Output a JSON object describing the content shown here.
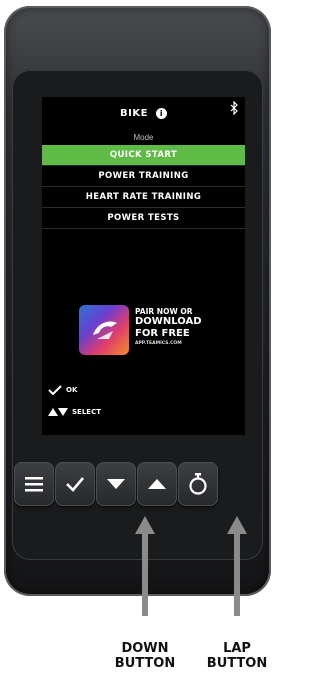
{
  "header": {
    "title": "BIKE",
    "info_glyph": "i"
  },
  "mode_label": "Mode",
  "menu": {
    "items": [
      {
        "label": "QUICK START",
        "selected": true
      },
      {
        "label": "POWER TRAINING"
      },
      {
        "label": "HEART RATE TRAINING"
      },
      {
        "label": "POWER TESTS"
      }
    ]
  },
  "promo": {
    "line1": "PAIR NOW OR",
    "line2": "DOWNLOAD",
    "line3": "FOR FREE",
    "url": "APP.TEAMICS.COM"
  },
  "legend": {
    "ok": "OK",
    "select": "SELECT"
  },
  "buttons": [
    "menu-icon",
    "check-icon",
    "down-arrow-icon",
    "up-arrow-icon",
    "stopwatch-icon"
  ],
  "callouts": {
    "down": {
      "line1": "DOWN",
      "line2": "BUTTON"
    },
    "lap": {
      "line1": "LAP",
      "line2": "BUTTON"
    }
  },
  "colors": {
    "accent": "#5dbb46",
    "screen": "#000000",
    "device": "#2a2b2d",
    "arrow": "#8a8a8a"
  }
}
